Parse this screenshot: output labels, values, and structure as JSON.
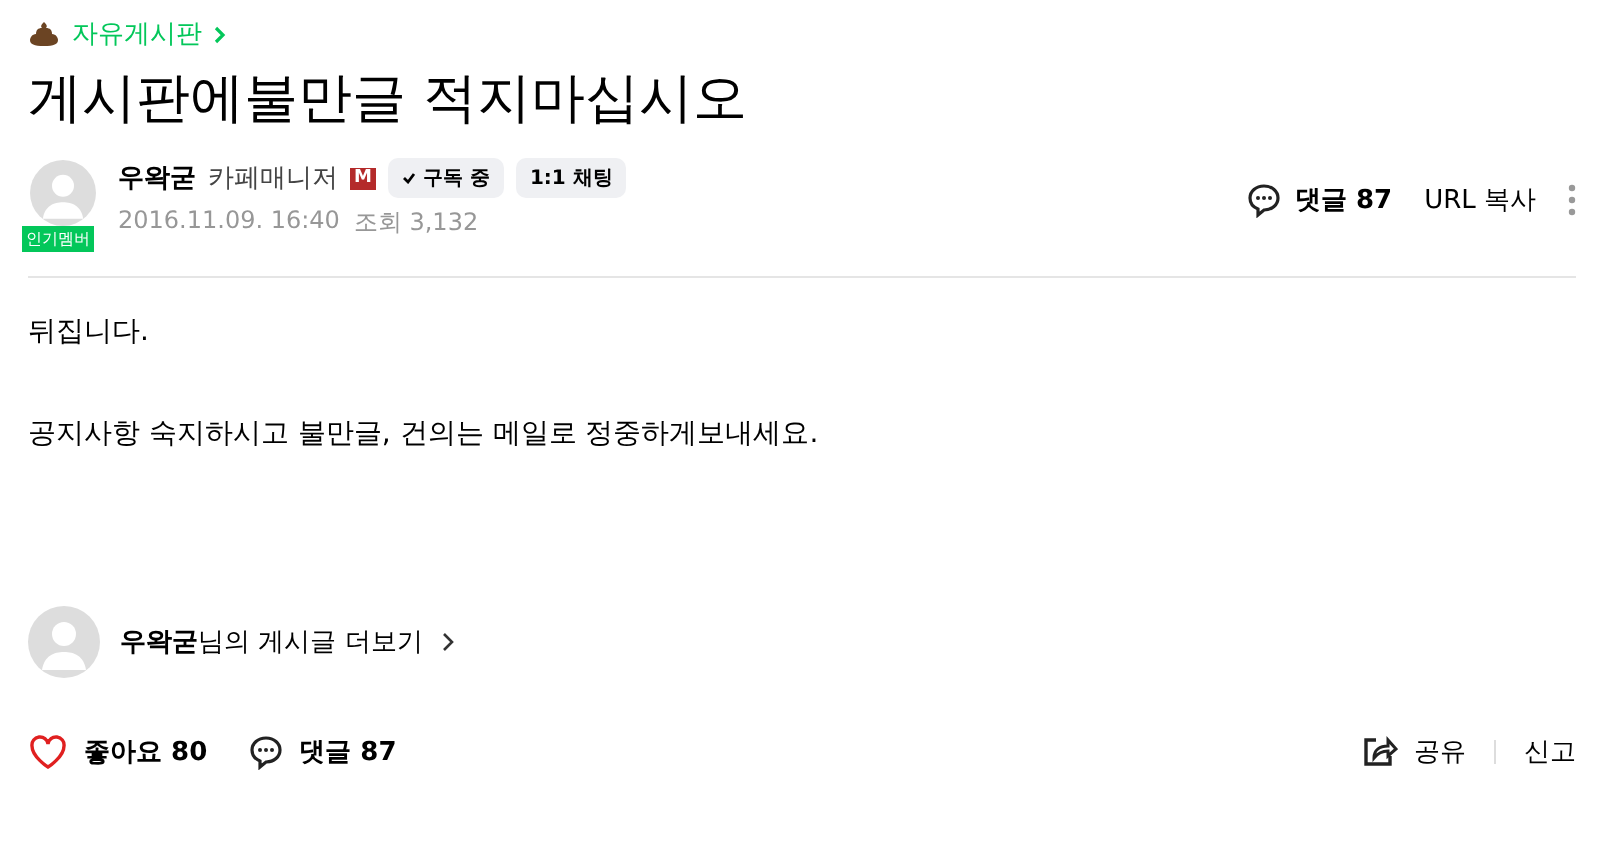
{
  "breadcrumb": {
    "board": "자유게시판"
  },
  "title": "게시판에불만글 적지마십시오",
  "author": {
    "name": "우왁굳",
    "role": "카페매니저",
    "manager_badge": "M",
    "member_badge": "인기멤버",
    "subscribe": "구독 중",
    "chat": "1:1 채팅",
    "date": "2016.11.09. 16:40",
    "views": "조회 3,132"
  },
  "top_actions": {
    "comments": "댓글 87",
    "copy_url": "URL 복사"
  },
  "body": [
    "뒤집니다.",
    "공지사항 숙지하시고 불만글, 건의는 메일로 정중하게보내세요."
  ],
  "more_posts": "**우왁굳**님의 게시글 더보기",
  "bottom_actions": {
    "likes": "좋아요 80",
    "comments": "댓글 87",
    "share": "공유",
    "report": "신고"
  }
}
